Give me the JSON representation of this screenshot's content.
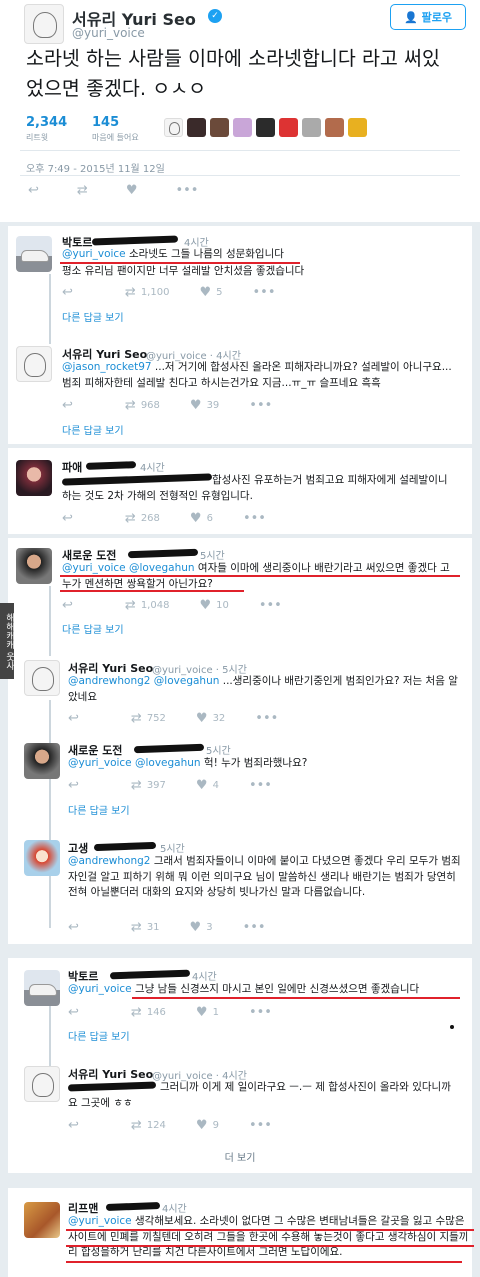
{
  "main": {
    "author": "서유리 Yuri Seo",
    "handle": "@yuri_voice",
    "follow_label": "팔로우",
    "text": "소라넷 하는 사람들 이마에 소라넷합니다 라고 써있었으면 좋겠다. ㅇㅅㅇ",
    "retweets": "2,344",
    "retweets_label": "리트윗",
    "likes": "145",
    "likes_label": "마음에 들어요",
    "timestamp": "오후 7:49 - 2015년 11월 12일"
  },
  "replies": [
    {
      "name": "박토르",
      "time": "4시간",
      "mention": "@yuri_voice",
      "text": "소라넷도 그들 나름의 성문화입니다",
      "text2": "평소 유리님 팬이지만 너무 설레발 안치셨음 좋겠습니다",
      "retweets": "1,100",
      "likes": "5",
      "more": "다른 답글 보기"
    },
    {
      "name": "서유리 Yuri Seo",
      "handle": "@yuri_voice · 4시간",
      "mention": "@jason_rocket97",
      "text": "...저 거기에 합성사진 올라온 피해자라니까요? 설레발이 아니구요... 범죄 피해자한테 설레발 친다고 하시는건가요 지금...ㅠ_ㅠ 슬프네요 흑흑",
      "retweets": "968",
      "likes": "39",
      "more": "다른 답글 보기"
    },
    {
      "name": "파애",
      "time": "4시간",
      "text": "합성사진 유포하는거 범죄고요 피해자에게 설레발이니 하는 것도 2차 가해의 전형적인 유형입니다.",
      "retweets": "268",
      "likes": "6"
    },
    {
      "name": "새로운 도전",
      "time": "5시간",
      "mention": "@yuri_voice @lovegahun",
      "text": "여자들 이마에 생리중이나 배란기라고 써있으면 좋겠다 고 누가 멘션하면 쌍욕할거 아닌가요?",
      "retweets": "1,048",
      "likes": "10",
      "more": "다른 답글 보기"
    },
    {
      "name": "서유리 Yuri Seo",
      "handle": "@yuri_voice · 5시간",
      "mention": "@andrewhong2 @lovegahun",
      "text": "...생리중이나 배란기중인게 범죄인가요? 저는 처음 알았네요",
      "retweets": "752",
      "likes": "32"
    },
    {
      "name": "새로운 도전",
      "time": "5시간",
      "mention": "@yuri_voice @lovegahun",
      "text": "헉! 누가 범죄라했나요?",
      "retweets": "397",
      "likes": "4",
      "more": "다른 답글 보기"
    },
    {
      "name": "고생",
      "time": "5시간",
      "mention": "@andrewhong2",
      "text": "그래서 범죄자들이니 이마에 붙이고 다녔으면 좋겠다 우리 모두가 범죄자인걸 알고 피하기 위해 뭐 이런 의미구요 님이 말씀하신 생리나 배란기는 범죄가 당연히 전혀 아닐뿐더러 대화의 요지와 상당히 빗나가신 말과 다름없습니다.",
      "retweets": "31",
      "likes": "3"
    },
    {
      "name": "박토르",
      "time": "4시간",
      "mention": "@yuri_voice",
      "text": "그냥 남들 신경쓰지 마시고 본인 일에만 신경쓰셨으면 좋겠습니다",
      "retweets": "146",
      "likes": "1",
      "more": "다른 답글 보기"
    },
    {
      "name": "서유리 Yuri Seo",
      "handle": "@yuri_voice · 4시간",
      "text": "그러니까 이게 제 일이라구요 ㅡ.ㅡ 제 합성사진이 올라와 있다니까요 그곳에 ㅎㅎ",
      "retweets": "124",
      "likes": "9"
    },
    {
      "name": "리프맨",
      "time": "4시간",
      "mention": "@yuri_voice",
      "text": "생각해보세요. 소라넷이 없다면 그 수많은 변태남녀들은 갈곳을 잃고 수많은 사이트에 민폐를 끼칠텐데 오히려 그들을 한곳에 수용해 놓는것이 좋다고 생각하심이 지들끼리 합성을하거 난리를 치건 다른사이트에서 그러면 노답이에요."
    }
  ],
  "show_more": "더 보기",
  "watermark": "해해캐캐 웃사",
  "colors": {
    "link": "#1b8dd5",
    "verified": "#1da1f2",
    "underline": "#e0212b"
  }
}
